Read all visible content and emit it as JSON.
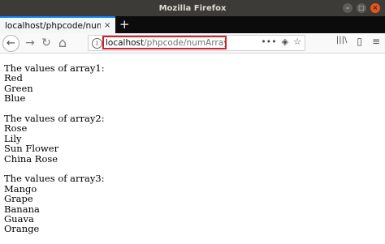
{
  "window": {
    "title": "Mozilla Firefox",
    "minimize_glyph": "–",
    "maximize_glyph": "□",
    "close_glyph": "×"
  },
  "tabs": [
    {
      "title": "localhost/phpcode/numArra",
      "close_glyph": "×",
      "active": true
    }
  ],
  "new_tab_glyph": "+",
  "nav": {
    "back_glyph": "←",
    "forward_glyph": "→",
    "reload_glyph": "↻",
    "home_glyph": "⌂"
  },
  "url": {
    "host": "localhost",
    "path": "/phpcode/numArray.php",
    "info_glyph": "i",
    "more_glyph": "•••",
    "pocket_glyph": "◈",
    "bookmark_glyph": "☆"
  },
  "toolbar": {
    "library_glyph": "|||\\",
    "sidebar_glyph": "▯",
    "menu_glyph": "≡"
  },
  "page": {
    "arrays": [
      {
        "heading": "The values of array1:",
        "items": [
          "Red",
          "Green",
          "Blue"
        ]
      },
      {
        "heading": "The values of array2:",
        "items": [
          "Rose",
          "Lily",
          "Sun Flower",
          "China Rose"
        ]
      },
      {
        "heading": "The values of array3:",
        "items": [
          "Mango",
          "Grape",
          "Banana",
          "Guava",
          "Orange"
        ]
      }
    ]
  },
  "colors": {
    "titlebar": "#3c3b37",
    "tab_accent": "#0a84ff",
    "url_highlight_border": "#d1202c"
  }
}
